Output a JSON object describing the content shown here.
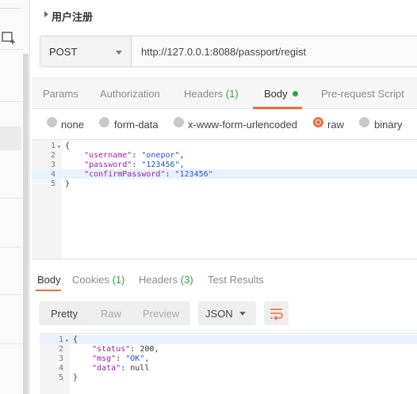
{
  "request": {
    "title": "用户注册",
    "method": "POST",
    "url": "http://127.0.0.1:8088/passport/regist"
  },
  "request_tabs": {
    "params": "Params",
    "authorization": "Authorization",
    "headers": "Headers",
    "headers_count": "(1)",
    "body": "Body",
    "prerequest": "Pre-request Script"
  },
  "body_types": {
    "none": "none",
    "form_data": "form-data",
    "urlencoded": "x-www-form-urlencoded",
    "raw": "raw",
    "binary": "binary",
    "selected": "raw"
  },
  "request_body": {
    "line_numbers": [
      "1",
      "2",
      "3",
      "4",
      "5"
    ],
    "open": "{",
    "username_key": "\"username\"",
    "username_value": "\"onepor\"",
    "password_key": "\"password\"",
    "password_value": "\"123456\"",
    "confirm_key": "\"confirmPassword\"",
    "confirm_value": "\"123456\"",
    "close": "}"
  },
  "response_tabs": {
    "body": "Body",
    "cookies": "Cookies",
    "cookies_count": "(1)",
    "headers": "Headers",
    "headers_count": "(3)",
    "test_results": "Test Results"
  },
  "response_toolbar": {
    "pretty": "Pretty",
    "raw": "Raw",
    "preview": "Preview",
    "format": "JSON"
  },
  "response_body": {
    "line_numbers": [
      "1",
      "2",
      "3",
      "4",
      "5"
    ],
    "open": "{",
    "status_key": "\"status\"",
    "status_value": "200",
    "msg_key": "\"msg\"",
    "msg_value": "\"OK\"",
    "data_key": "\"data\"",
    "data_value": "null",
    "close": "}"
  },
  "colors": {
    "accent": "#f26b3a",
    "count_green": "#34a14b",
    "json_key": "#a21caf",
    "json_string": "#1d4fd8"
  }
}
